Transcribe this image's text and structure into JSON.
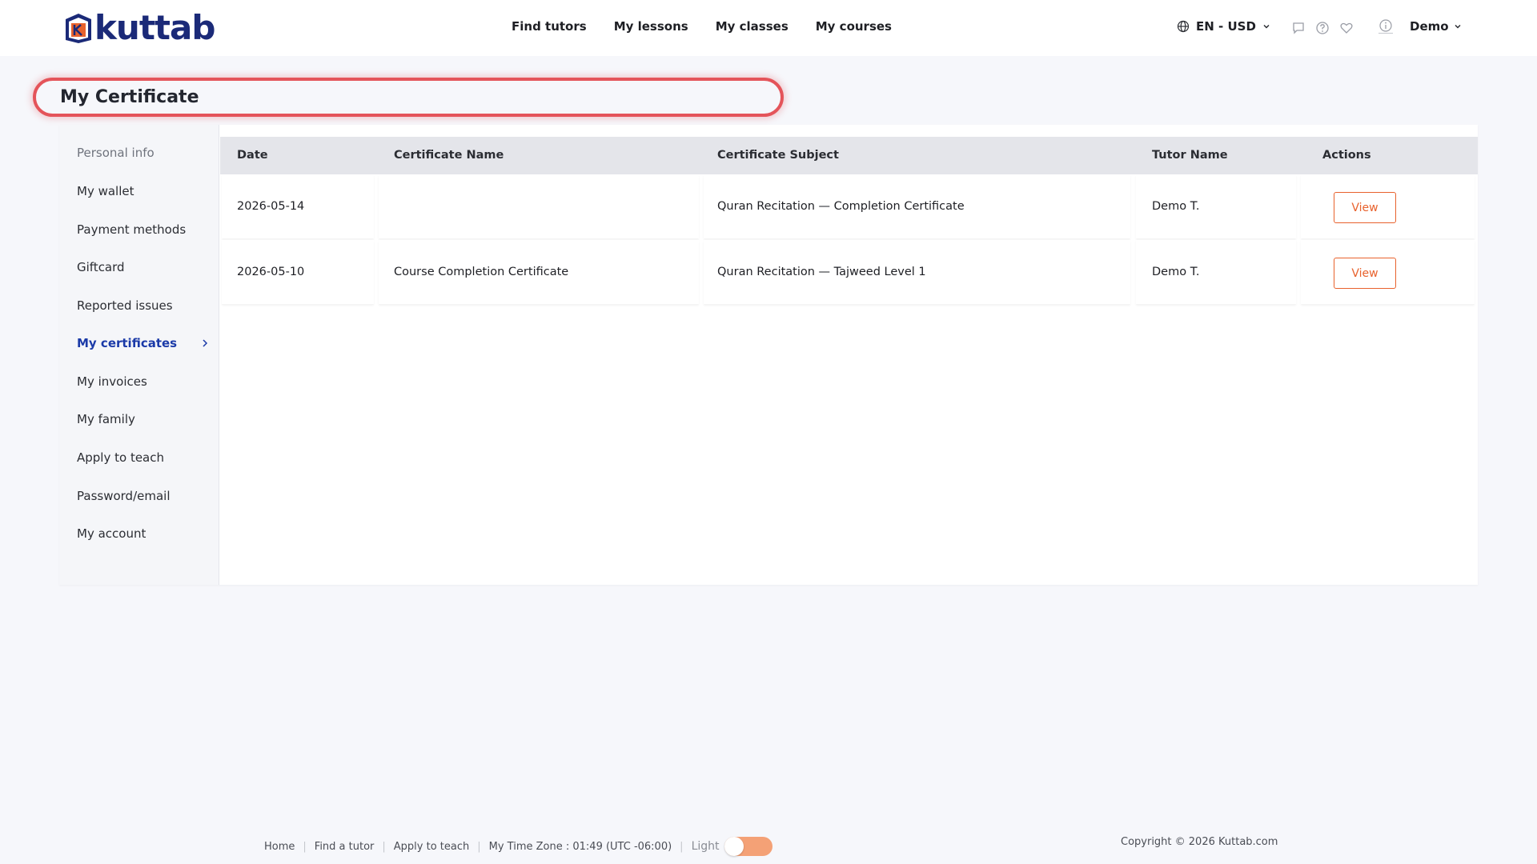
{
  "header": {
    "logo_text": "kuttab",
    "nav": [
      "Find tutors",
      "My lessons",
      "My classes",
      "My courses"
    ],
    "locale": "EN - USD",
    "user": "Demo",
    "icons": [
      "globe-icon",
      "chat-icon",
      "help-icon",
      "heart-icon",
      "info-icon"
    ]
  },
  "page": {
    "title": "My Certificate"
  },
  "sidebar": {
    "items": [
      {
        "label": "Personal info",
        "state": "muted"
      },
      {
        "label": "My wallet"
      },
      {
        "label": "Payment methods"
      },
      {
        "label": "Giftcard"
      },
      {
        "label": "Reported issues"
      },
      {
        "label": "My certificates",
        "state": "active"
      },
      {
        "label": "My invoices"
      },
      {
        "label": "My family"
      },
      {
        "label": "Apply to teach"
      },
      {
        "label": "Password/email"
      },
      {
        "label": "My account"
      }
    ]
  },
  "table": {
    "columns": [
      "Date",
      "Certificate Name",
      "Certificate Subject",
      "Tutor Name",
      "Actions"
    ],
    "rows": [
      {
        "date": "2026-05-14",
        "name": "",
        "subject": "Quran Recitation — Completion Certificate",
        "tutor": "Demo T.",
        "action": "View"
      },
      {
        "date": "2026-05-10",
        "name": "Course Completion Certificate",
        "subject": "Quran Recitation — Tajweed Level 1",
        "tutor": "Demo T.",
        "action": "View"
      }
    ]
  },
  "footer": {
    "links": [
      "Home",
      "Find a tutor",
      "Apply to teach"
    ],
    "timezone": "My Time Zone : 01:49 (UTC -06:00)",
    "theme_label": "Light",
    "copyright": "Copyright © 2026 Kuttab.com"
  },
  "colors": {
    "accent": "#e8622d",
    "brand": "#1b2a78",
    "highlight": "#e4545a",
    "active_nav": "#1b3aa8"
  }
}
